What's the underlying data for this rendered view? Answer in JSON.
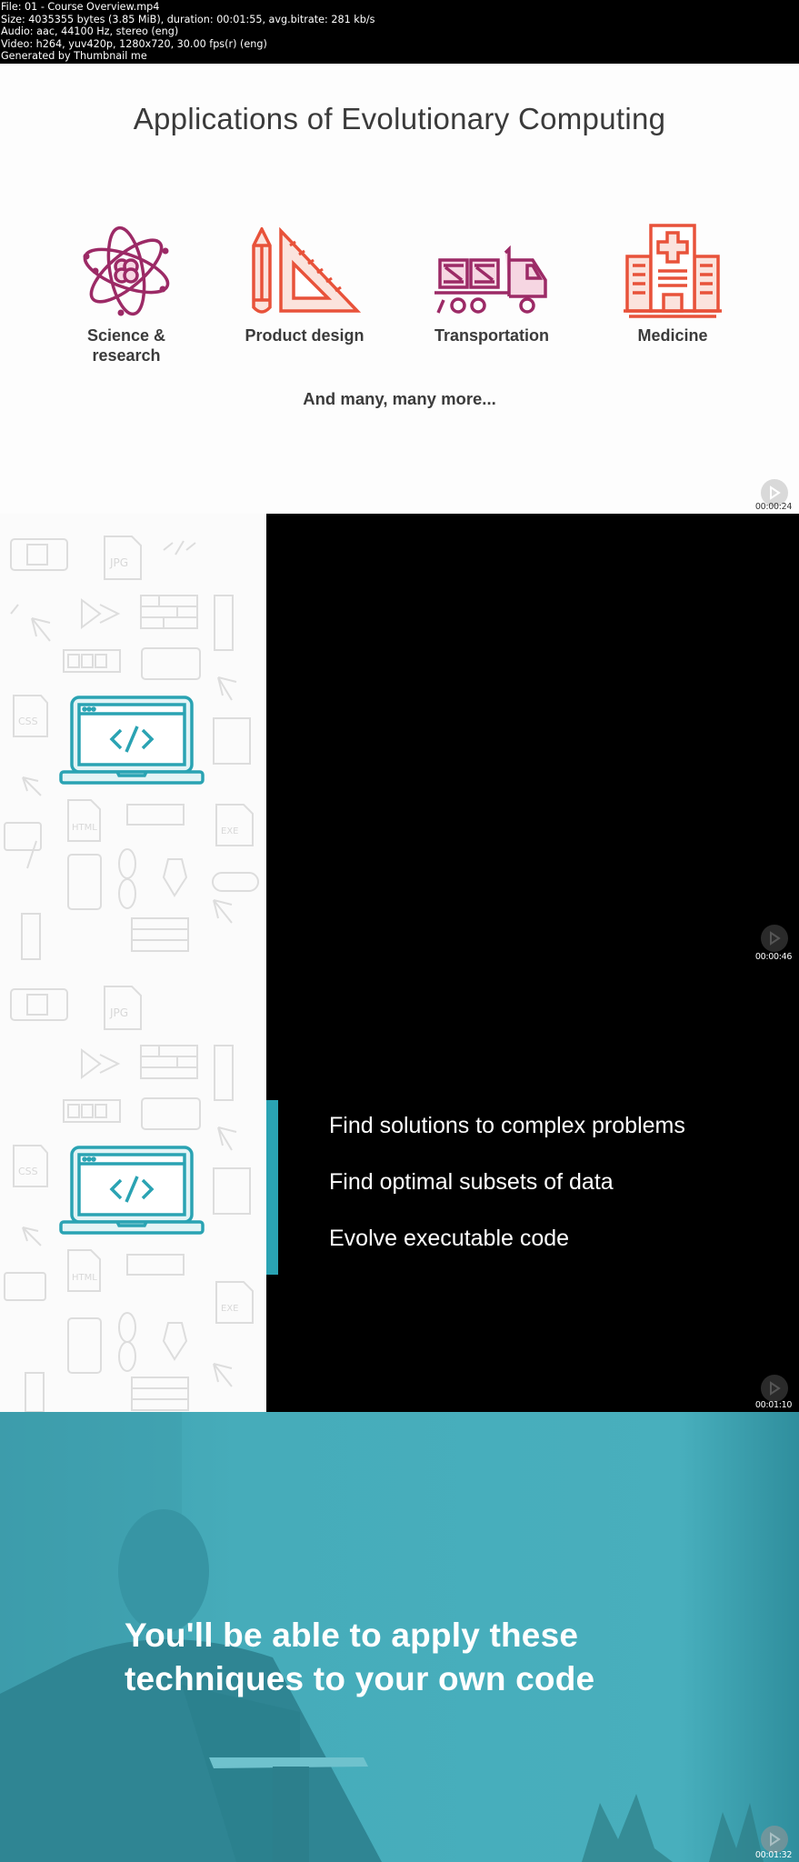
{
  "file_info": {
    "lines": [
      "File: 01 - Course Overview.mp4",
      "Size: 4035355 bytes (3.85 MiB), duration: 00:01:55, avg.bitrate: 281 kb/s",
      "Audio: aac, 44100 Hz, stereo (eng)",
      "Video: h264, yuv420p, 1280x720, 30.00 fps(r) (eng)",
      "Generated by Thumbnail me"
    ]
  },
  "frames": [
    {
      "timestamp": "00:00:24",
      "title": "Applications of Evolutionary Computing",
      "applications": [
        {
          "icon": "atom-icon",
          "label_line1": "Science &",
          "label_line2": "research",
          "color": "#9c2a66"
        },
        {
          "icon": "pencil-triangle-ruler-icon",
          "label_line1": "Product design",
          "label_line2": "",
          "color": "#e8523a"
        },
        {
          "icon": "truck-icon",
          "label_line1": "Transportation",
          "label_line2": "",
          "color": "#9c2a66"
        },
        {
          "icon": "hospital-icon",
          "label_line1": "Medicine",
          "label_line2": "",
          "color": "#e8523a"
        }
      ],
      "footer": "And many, many more..."
    },
    {
      "timestamp": "00:00:46"
    },
    {
      "timestamp": "00:01:10",
      "bullets": [
        "Find solutions to complex problems",
        "Find optimal subsets of data",
        "Evolve executable code"
      ]
    },
    {
      "timestamp": "00:01:32",
      "headline_line1": "You'll be able to apply these",
      "headline_line2": "techniques to your own code"
    }
  ],
  "colors": {
    "accent_teal": "#2aa3b3",
    "brand_magenta": "#9c2a66",
    "brand_orange": "#e8523a",
    "teal_overlay": "#45adbb"
  }
}
